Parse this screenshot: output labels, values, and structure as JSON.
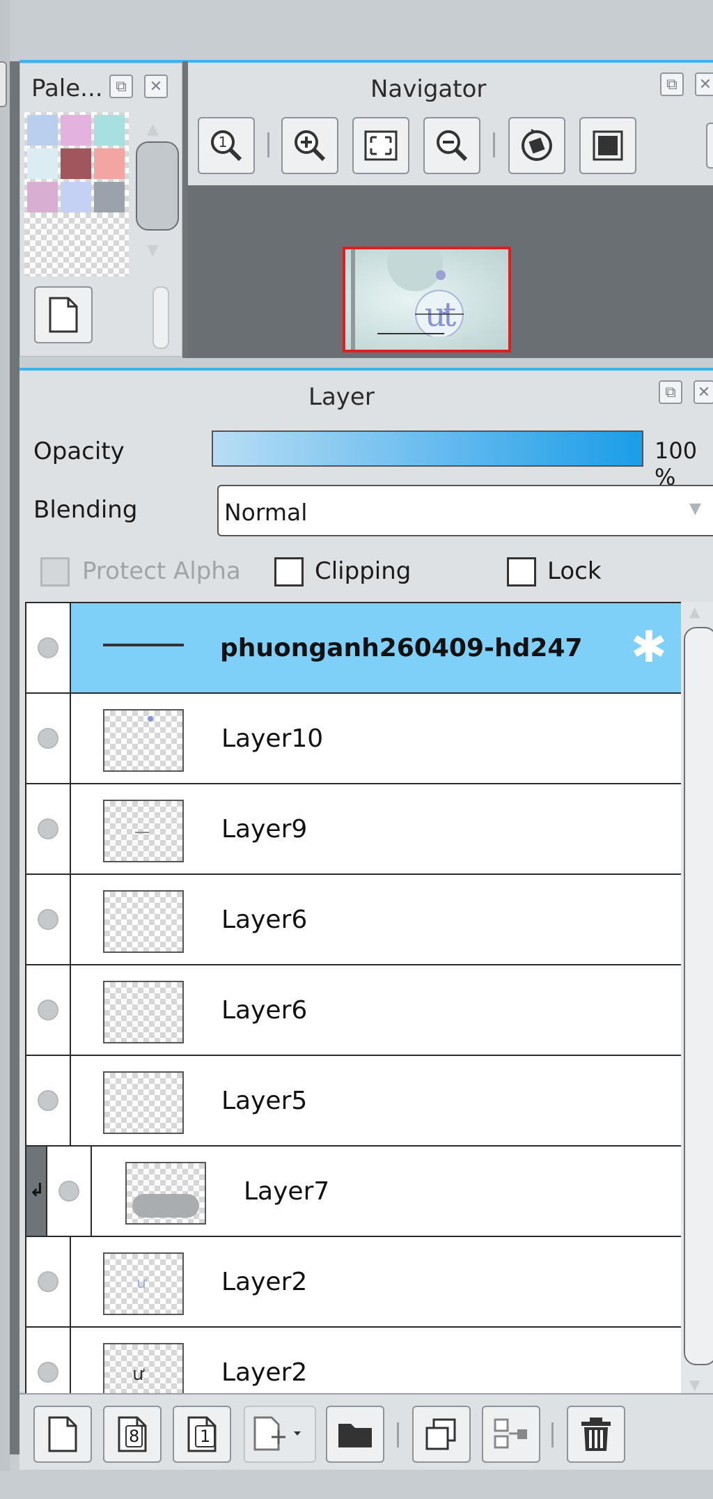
{
  "palette": {
    "title": "Pale...",
    "swatches": [
      "#b9cfee",
      "#e3b2de",
      "#a8dfe0",
      "#dcecf3",
      "#a1565e",
      "#f3a6a1",
      "#d8afd2",
      "#c4d1f5",
      "#9aa3ab"
    ]
  },
  "navigator": {
    "title": "Navigator",
    "preview_border_color": "#e01e1e"
  },
  "layer_panel": {
    "title": "Layer",
    "opacity_label": "Opacity",
    "opacity_value": "100 %",
    "opacity_fraction": 1.0,
    "blending_label": "Blending",
    "blending_value": "Normal",
    "protect_alpha_label": "Protect Alpha",
    "clipping_label": "Clipping",
    "lock_label": "Lock",
    "selected_color": "#7fd0f8",
    "layers": [
      {
        "name": "phuonganh260409-hd247",
        "selected": true,
        "bold": true
      },
      {
        "name": "Layer10",
        "selected": false
      },
      {
        "name": "Layer9",
        "selected": false
      },
      {
        "name": "Layer6",
        "selected": false
      },
      {
        "name": "Layer6",
        "selected": false
      },
      {
        "name": "Layer5",
        "selected": false
      },
      {
        "name": "Layer7",
        "selected": false,
        "clipped": true
      },
      {
        "name": "Layer2",
        "selected": false
      },
      {
        "name": "Layer2",
        "selected": false
      }
    ]
  },
  "toolbar": {
    "icons": [
      "new-layer-icon",
      "new-layer-8bit-icon",
      "new-layer-1bit-icon",
      "add-layer-dropdown-icon",
      "folder-icon",
      "duplicate-layer-icon",
      "merge-down-icon",
      "delete-layer-icon"
    ],
    "badge_8": "8",
    "badge_1": "1"
  }
}
